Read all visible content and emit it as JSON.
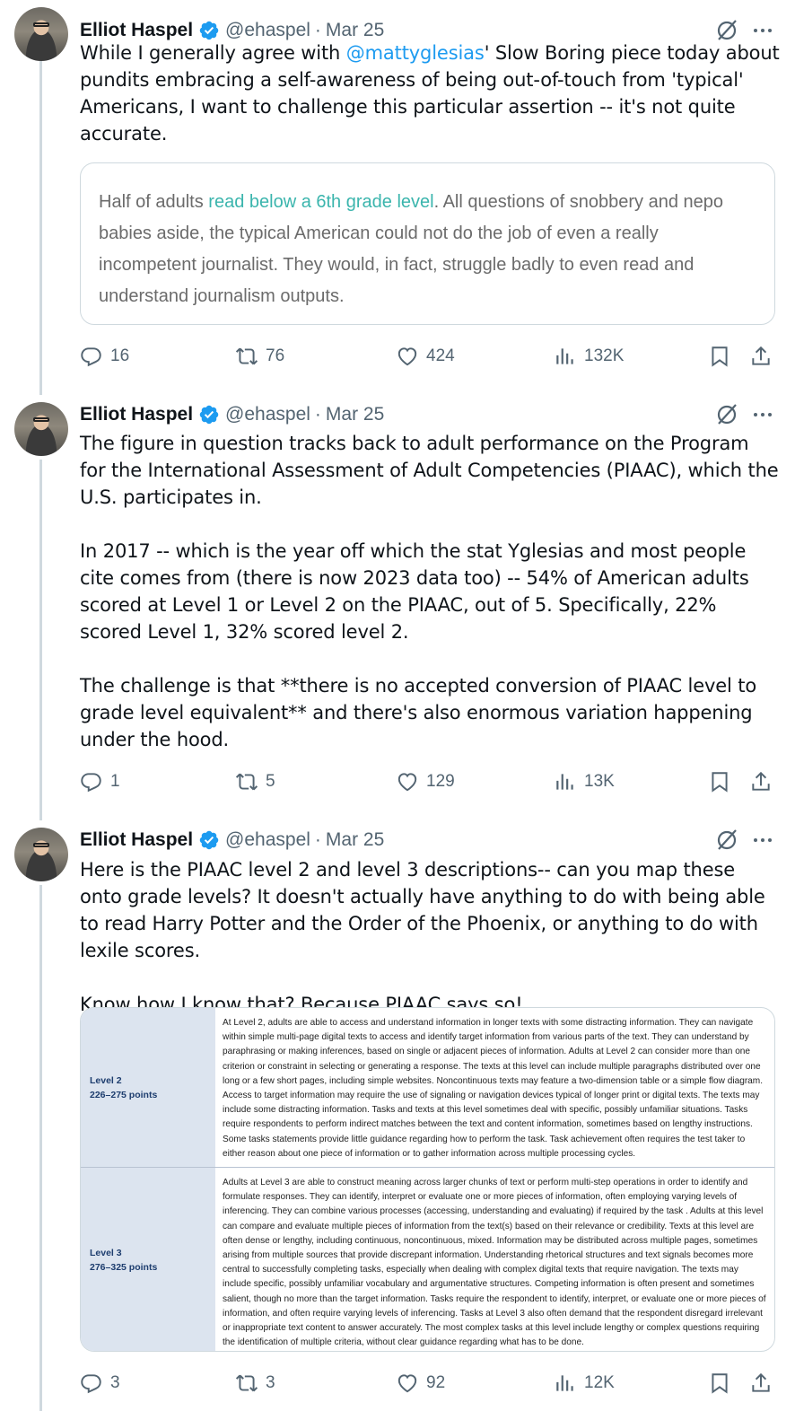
{
  "tweets": [
    {
      "author": {
        "name": "Elliot Haspel",
        "handle": "@ehaspel",
        "date": "Mar 25"
      },
      "text_parts": {
        "p1_pre": "While I generally agree with ",
        "p1_mention": "@mattyglesias",
        "p1_post": "' Slow Boring piece today about pundits embracing a self-awareness of being out-of-touch from 'typical' Americans, I want to challenge this particular assertion -- it's not quite accurate."
      },
      "quote": {
        "pre": "Half of adults ",
        "link": "read below a 6th grade level",
        "post": ". All questions of snobbery and nepo babies aside, the typical American could not do the job of even a really incompetent journalist. They would, in fact, struggle badly to even read and understand journalism outputs."
      },
      "stats": {
        "replies": "16",
        "reposts": "76",
        "likes": "424",
        "views": "132K"
      }
    },
    {
      "author": {
        "name": "Elliot Haspel",
        "handle": "@ehaspel",
        "date": "Mar 25"
      },
      "paragraphs": [
        "The figure in question tracks back to adult performance on the Program for the International Assessment of Adult Competencies (PIAAC), which the U.S. participates in.",
        "In 2017 -- which is the year off which the stat Yglesias and most people cite comes from (there is now 2023 data too) -- 54% of American adults scored at Level 1 or Level 2 on the PIAAC, out of 5. Specifically, 22% scored Level 1, 32% scored level 2.",
        "The challenge is that **there is no accepted conversion of PIAAC level to grade level equivalent** and there's also enormous variation happening under the hood."
      ],
      "stats": {
        "replies": "1",
        "reposts": "5",
        "likes": "129",
        "views": "13K"
      }
    },
    {
      "author": {
        "name": "Elliot Haspel",
        "handle": "@ehaspel",
        "date": "Mar 25"
      },
      "paragraphs": [
        "Here is the PIAAC level 2 and level 3 descriptions-- can you map these onto grade levels? It doesn't actually have anything to do with being able to read Harry Potter and the Order of the Phoenix, or anything to do with lexile scores.",
        "Know how I know that? Because PIAAC says so!"
      ],
      "table": {
        "rows": [
          {
            "level": "Level 2",
            "points": "226–275 points",
            "description": "At Level 2, adults are able to access and understand information in longer texts with some distracting information. They can navigate within simple multi-page digital texts to access and identify target information from various parts of the text. They can understand by paraphrasing or making inferences, based on single or adjacent pieces of information. Adults at Level 2 can consider more than one criterion or constraint in selecting or generating a response. The texts at this level can include multiple paragraphs distributed over one long or a few short pages, including simple websites. Noncontinuous texts may feature a two-dimension table or a simple flow diagram. Access to target information may require the use of signaling or navigation devices typical of longer print or digital texts. The texts may include some distracting information. Tasks and texts at this level sometimes deal with specific, possibly unfamiliar situations. Tasks require respondents to perform indirect matches between the text and content information, sometimes based on lengthy instructions. Some tasks statements provide little guidance regarding how to perform the task. Task achievement often requires the test taker to either reason about one piece of information or to gather information across multiple processing cycles."
          },
          {
            "level": "Level 3",
            "points": "276–325 points",
            "description": "Adults at Level 3 are able to construct meaning across larger chunks of text or perform multi-step operations in order to identify and formulate responses. They can identify, interpret or evaluate one or more pieces of information, often employing varying levels of inferencing. They can combine various processes (accessing, understanding and evaluating) if required by the task . Adults at this level can compare and evaluate multiple pieces of information from the text(s) based on their relevance or credibility. Texts at this level are often dense or lengthy, including continuous, noncontinuous, mixed. Information may be distributed across multiple pages, sometimes arising from multiple sources that provide discrepant information. Understanding rhetorical structures and text signals becomes more central to successfully completing tasks, especially when dealing with complex digital texts that require navigation. The texts may include specific, possibly unfamiliar vocabulary and argumentative structures. Competing information is often present and sometimes salient, though no more than the target information. Tasks require the respondent to identify, interpret, or evaluate one or more pieces of information, and often require varying levels of inferencing. Tasks at Level 3 also often demand that the respondent disregard irrelevant or inappropriate text content to answer accurately. The most complex tasks at this level include lengthy or complex questions requiring the identification of multiple criteria, without clear guidance regarding what has to be done."
          }
        ]
      },
      "stats": {
        "replies": "3",
        "reposts": "3",
        "likes": "92",
        "views": "12K"
      }
    }
  ],
  "colors": {
    "verified": "#1d9bf0",
    "link": "#1d9bf0",
    "muted": "#536471",
    "quote_link": "#3bb5ad"
  },
  "icons": [
    "verified-badge-icon",
    "grok-icon",
    "more-icon",
    "reply-icon",
    "repost-icon",
    "like-icon",
    "views-icon",
    "bookmark-icon",
    "share-icon"
  ]
}
